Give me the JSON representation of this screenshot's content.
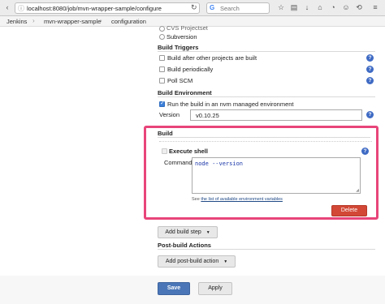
{
  "browser": {
    "url": "localhost:8080/job/mvn-wrapper-sample/configure",
    "search_placeholder": "Search"
  },
  "breadcrumb": [
    "Jenkins",
    "mvn-wrapper-sample",
    "configuration"
  ],
  "scm": {
    "cvs_label": "CVS Projectset",
    "subversion_label": "Subversion"
  },
  "build_triggers": {
    "title": "Build Triggers",
    "items": [
      "Build after other projects are built",
      "Build periodically",
      "Poll SCM"
    ]
  },
  "build_environment": {
    "title": "Build Environment",
    "nvm_label": "Run the build in an nvm managed environment",
    "nvm_checked": true,
    "version_label": "Version",
    "version_value": "v0.10.25"
  },
  "build": {
    "title": "Build",
    "step_title": "Execute shell",
    "command_label": "Command",
    "command_value": "node --version",
    "see_prefix": "See ",
    "see_link": "the list of available environment variables",
    "delete_label": "Delete",
    "add_step_label": "Add build step"
  },
  "post_build": {
    "title": "Post-build Actions",
    "add_action_label": "Add post-build action"
  },
  "footer": {
    "save_label": "Save",
    "apply_label": "Apply"
  },
  "colors": {
    "highlight": "#e8457a",
    "delete": "#d24735",
    "save": "#4a76b7"
  }
}
